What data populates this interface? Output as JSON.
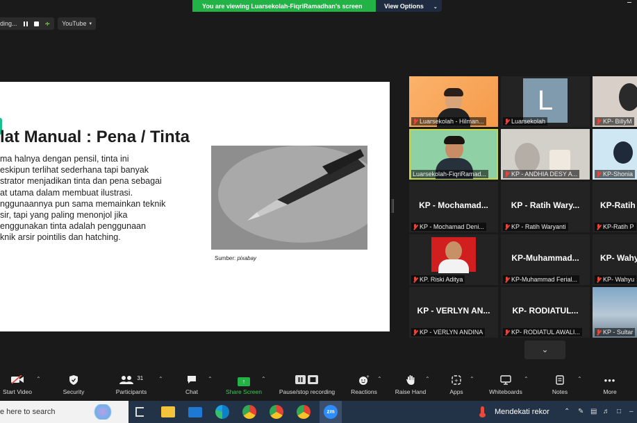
{
  "banner": {
    "message": "You are viewing Luarsekolah-FiqriRamadhan's screen",
    "view_options": "View Options"
  },
  "recording": {
    "status": "ding...",
    "youtube": "YouTube"
  },
  "slide": {
    "title": "lat Manual : Pena / Tinta",
    "body_lines": [
      "ma halnya dengan pensil, tinta ini",
      "eskipun terlihat sederhana tapi banyak",
      "strator menjadikan tinta dan pena sebagai",
      "at utama dalam membuat ilustrasi.",
      "nggunaannya pun sama memainkan teknik",
      "sir, tapi yang paling menonjol jika",
      "enggunakan tinta adalah penggunaan",
      "knik arsir pointilis dan hatching."
    ],
    "source_label": "Sumber:",
    "source_name": "pixabay"
  },
  "gallery": {
    "tiles": [
      {
        "name": "Luarsekolah - Hilman...",
        "big": ""
      },
      {
        "name": "Luarsekolah",
        "big": "",
        "avatar": "L"
      },
      {
        "name": "KP- BillyM",
        "big": ""
      },
      {
        "name": "Luarsekolah-FiqriRamad...",
        "big": ""
      },
      {
        "name": "KP - ANDHIA DESY A...",
        "big": ""
      },
      {
        "name": "KP-Shonia",
        "big": ""
      },
      {
        "name": "KP - Mochamad Deni...",
        "big": "KP - Mochamad..."
      },
      {
        "name": "KP - Ratih Waryanti",
        "big": "KP - Ratih Wary..."
      },
      {
        "name": "KP-Ratih P",
        "big": "KP-Ratih"
      },
      {
        "name": "KP. Riski Aditya",
        "big": ""
      },
      {
        "name": "KP-Muhammad Ferial...",
        "big": "KP-Muhammad..."
      },
      {
        "name": "KP- Wahyu",
        "big": "KP- Wahy"
      },
      {
        "name": "KP - VERLYN ANDINA",
        "big": "KP - VERLYN AN..."
      },
      {
        "name": "KP- RODIATUL AWALI...",
        "big": "KP- RODIATUL..."
      },
      {
        "name": "KP - Sultar",
        "big": ""
      }
    ]
  },
  "toolbar": {
    "start_video": "Start Video",
    "security": "Security",
    "participants": "Participants",
    "participants_count": "31",
    "chat": "Chat",
    "share_screen": "Share Screen",
    "pause_stop": "Pause/stop recording",
    "reactions": "Reactions",
    "raise_hand": "Raise Hand",
    "apps": "Apps",
    "whiteboards": "Whiteboards",
    "notes": "Notes",
    "more": "More"
  },
  "taskbar": {
    "search_placeholder": "e here to search",
    "weather": "Mendekati rekor",
    "zoom_label": "zm"
  }
}
